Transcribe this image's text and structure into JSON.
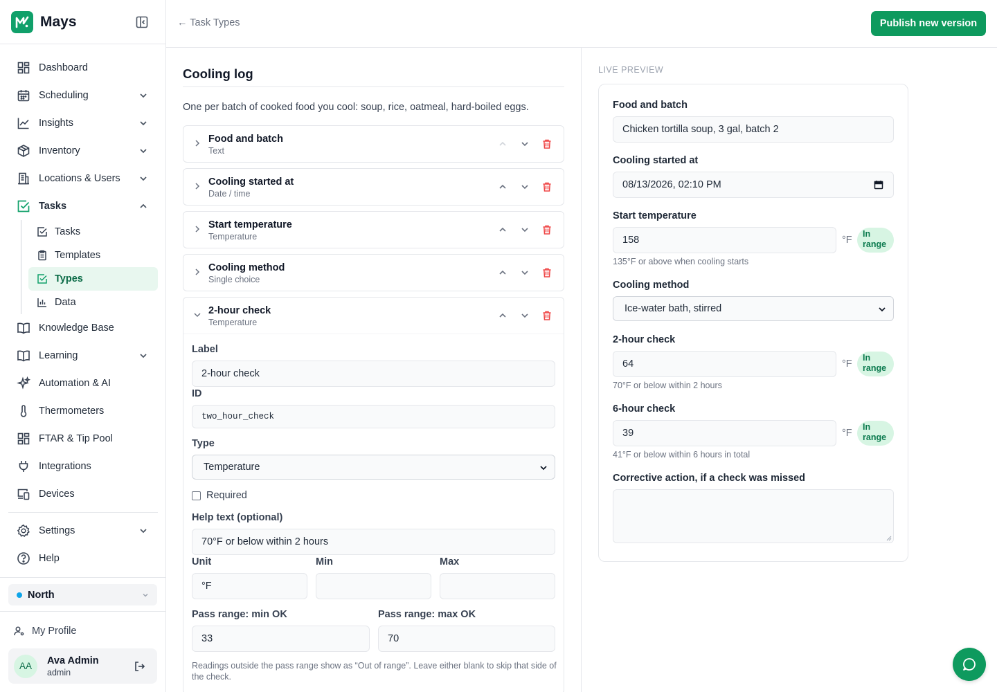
{
  "brand": {
    "name": "Mays"
  },
  "sidebar": {
    "items": [
      {
        "label": "Dashboard"
      },
      {
        "label": "Scheduling"
      },
      {
        "label": "Insights"
      },
      {
        "label": "Inventory"
      },
      {
        "label": "Locations & Users"
      },
      {
        "label": "Tasks"
      },
      {
        "label": "Knowledge Base"
      },
      {
        "label": "Learning"
      },
      {
        "label": "Automation & AI"
      },
      {
        "label": "Thermometers"
      },
      {
        "label": "FTAR & Tip Pool"
      },
      {
        "label": "Integrations"
      },
      {
        "label": "Devices"
      },
      {
        "label": "Settings"
      },
      {
        "label": "Help"
      }
    ],
    "tasks_sub": [
      {
        "label": "Tasks"
      },
      {
        "label": "Templates"
      },
      {
        "label": "Types"
      },
      {
        "label": "Data"
      }
    ],
    "location": "North",
    "my_profile": "My Profile",
    "user": {
      "initials": "AA",
      "name": "Ava Admin",
      "role": "admin"
    }
  },
  "header": {
    "back_label": "← Task Types",
    "publish_label": "Publish new version"
  },
  "editor": {
    "title": "Cooling log",
    "description": "One per batch of cooked food you cool: soup, rice, oatmeal, hard-boiled eggs.",
    "fields": [
      {
        "name": "Food and batch",
        "type": "Text"
      },
      {
        "name": "Cooling started at",
        "type": "Date / time"
      },
      {
        "name": "Start temperature",
        "type": "Temperature"
      },
      {
        "name": "Cooling method",
        "type": "Single choice"
      },
      {
        "name": "2-hour check",
        "type": "Temperature"
      }
    ],
    "expanded": {
      "label_label": "Label",
      "label_value": "2-hour check",
      "id_label": "ID",
      "id_value": "two_hour_check",
      "type_label": "Type",
      "type_value": "Temperature",
      "required_label": "Required",
      "help_label": "Help text (optional)",
      "help_value": "70°F or below within 2 hours",
      "unit_label": "Unit",
      "unit_value": "°F",
      "min_label": "Min",
      "min_value": "",
      "max_label": "Max",
      "max_value": "",
      "pass_min_label": "Pass range: min OK",
      "pass_min_value": "33",
      "pass_max_label": "Pass range: max OK",
      "pass_max_value": "70",
      "note": "Readings outside the pass range show as “Out of range”. Leave either blank to skip that side of the check."
    }
  },
  "preview": {
    "section_label": "LIVE PREVIEW",
    "food_label": "Food and batch",
    "food_value": "Chicken tortilla soup, 3 gal, batch 2",
    "started_label": "Cooling started at",
    "started_value": "08/13/2026, 02:10 PM",
    "start_temp_label": "Start temperature",
    "start_temp_value": "158",
    "start_temp_help": "135°F or above when cooling starts",
    "method_label": "Cooling method",
    "method_value": "Ice-water bath, stirred",
    "check2_label": "2-hour check",
    "check2_value": "64",
    "check2_help": "70°F or below within 2 hours",
    "check6_label": "6-hour check",
    "check6_value": "39",
    "check6_help": "41°F or below within 6 hours in total",
    "corrective_label": "Corrective action, if a check was missed",
    "unit": "°F",
    "badge": "In range"
  },
  "colors": {
    "brand": "#0e9a5e",
    "active_bg": "#e8f7ef",
    "delete": "#ef4444",
    "badge_bg": "#d7f5e3"
  }
}
